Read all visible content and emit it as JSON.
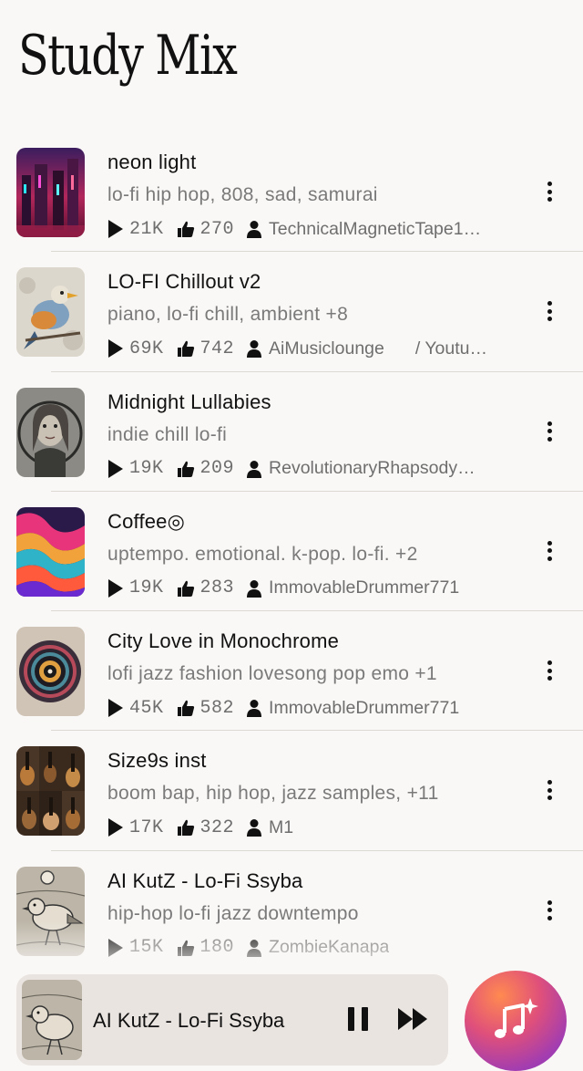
{
  "header": {
    "title": "Study Mix"
  },
  "tracks": [
    {
      "name": "neon light",
      "tags": "lo-fi hip hop, 808, sad, samurai",
      "plays": "21K",
      "likes": "270",
      "user": "TechnicalMagneticTape1…",
      "extra": "",
      "art": "neon-city-art"
    },
    {
      "name": "LO-FI Chillout v2",
      "tags": "piano, lo-fi chill, ambient +8",
      "plays": "69K",
      "likes": "742",
      "user": "AiMusiclounge",
      "extra": "/ Youtu…",
      "art": "bird-art"
    },
    {
      "name": "Midnight Lullabies",
      "tags": "indie chill lo-fi",
      "plays": "19K",
      "likes": "209",
      "user": "RevolutionaryRhapsody…",
      "extra": "",
      "art": "portrait-art"
    },
    {
      "name": "Coffee◎",
      "tags": "uptempo. emotional. k-pop. lo-fi. +2",
      "plays": "19K",
      "likes": "283",
      "user": "ImmovableDrummer771",
      "extra": "",
      "art": "swirl-art"
    },
    {
      "name": "City Love in Monochrome",
      "tags": "lofi jazz fashion lovesong pop emo +1",
      "plays": "45K",
      "likes": "582",
      "user": "ImmovableDrummer771",
      "extra": "",
      "art": "vinyl-art"
    },
    {
      "name": "Size9s inst",
      "tags": "boom bap, hip hop, jazz samples, +11",
      "plays": "17K",
      "likes": "322",
      "user": "M1",
      "extra": "",
      "art": "guitars-art"
    },
    {
      "name": "AI KutZ - Lo-Fi Ssyba",
      "tags": "hip-hop lo-fi jazz downtempo",
      "plays": "15K",
      "likes": "180",
      "user": "ZombieKanapa",
      "extra": "",
      "art": "sparrow-art"
    }
  ],
  "player": {
    "title": "AI KutZ - Lo-Fi Ssyba",
    "state": "playing"
  },
  "icons": {
    "play": "play-icon",
    "like": "thumbs-up-icon",
    "user": "user-icon",
    "more": "more-vertical-icon",
    "pause": "pause-icon",
    "next": "fast-forward-icon",
    "create": "music-sparkle-icon"
  }
}
